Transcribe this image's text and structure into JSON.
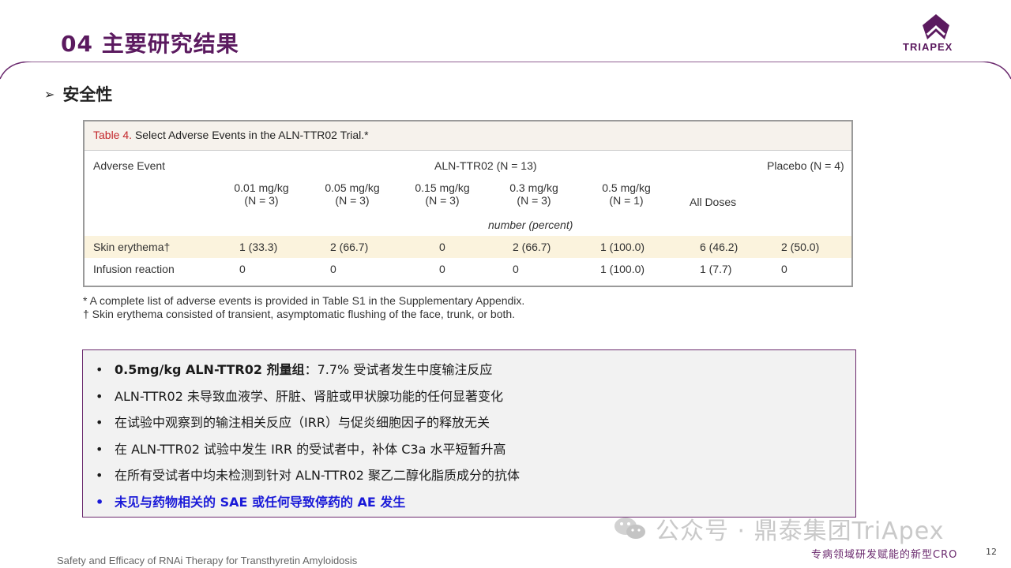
{
  "header": {
    "title": "04 主要研究结果",
    "logo_text": "TRIAPEX"
  },
  "section": {
    "marker": "➢",
    "title": "安全性"
  },
  "table": {
    "caption_label": "Table 4.",
    "caption_text": "Select Adverse Events in the ALN-TTR02 Trial.*",
    "col_adverse_event": "Adverse Event",
    "group_aln": "ALN-TTR02 (N = 13)",
    "group_placebo": "Placebo (N = 4)",
    "doses": [
      {
        "dose": "0.01 mg/kg",
        "n": "(N = 3)"
      },
      {
        "dose": "0.05 mg/kg",
        "n": "(N = 3)"
      },
      {
        "dose": "0.15 mg/kg",
        "n": "(N = 3)"
      },
      {
        "dose": "0.3 mg/kg",
        "n": "(N = 3)"
      },
      {
        "dose": "0.5 mg/kg",
        "n": "(N = 1)"
      }
    ],
    "all_doses": "All Doses",
    "unit_note": "number (percent)",
    "rows": [
      {
        "event": "Skin erythema†",
        "values": [
          "1 (33.3)",
          "2 (66.7)",
          "0",
          "2 (66.7)",
          "1 (100.0)",
          "6 (46.2)",
          "2 (50.0)"
        ]
      },
      {
        "event": "Infusion reaction",
        "values": [
          "0",
          "0",
          "0",
          "0",
          "1 (100.0)",
          "1 (7.7)",
          "0"
        ]
      }
    ]
  },
  "notes": [
    "* A complete list of adverse events is provided in Table S1 in the Supplementary Appendix.",
    "† Skin erythema consisted of transient, asymptomatic flushing of the face, trunk, or both."
  ],
  "bullets": {
    "b1_bold": "0.5mg/kg ALN-TTR02 剂量组",
    "b1_rest": "：7.7% 受试者发生中度输注反应",
    "b2": "ALN-TTR02 未导致血液学、肝脏、肾脏或甲状腺功能的任何显著变化",
    "b3": "在试验中观察到的输注相关反应（IRR）与促炎细胞因子的释放无关",
    "b4": "在 ALN-TTR02 试验中发生 IRR 的受试者中，补体 C3a 水平短暂升高",
    "b5": "在所有受试者中均未检测到针对 ALN-TTR02 聚乙二醇化脂质成分的抗体",
    "b6": "未见与药物相关的 SAE 或任何导致停药的 AE 发生",
    "bullet_char": "•"
  },
  "watermark": "公众号 · 鼎泰集团TriApex",
  "footer": {
    "left": "Safety and Efficacy of RNAi Therapy for Transthyretin Amyloidosis",
    "right": "专病领域研发赋能的新型CRO",
    "page": "12"
  },
  "colors": {
    "brand_purple": "#5b1a5f",
    "highlight_blue": "#1a1ad8",
    "caption_red": "#c3272b"
  }
}
